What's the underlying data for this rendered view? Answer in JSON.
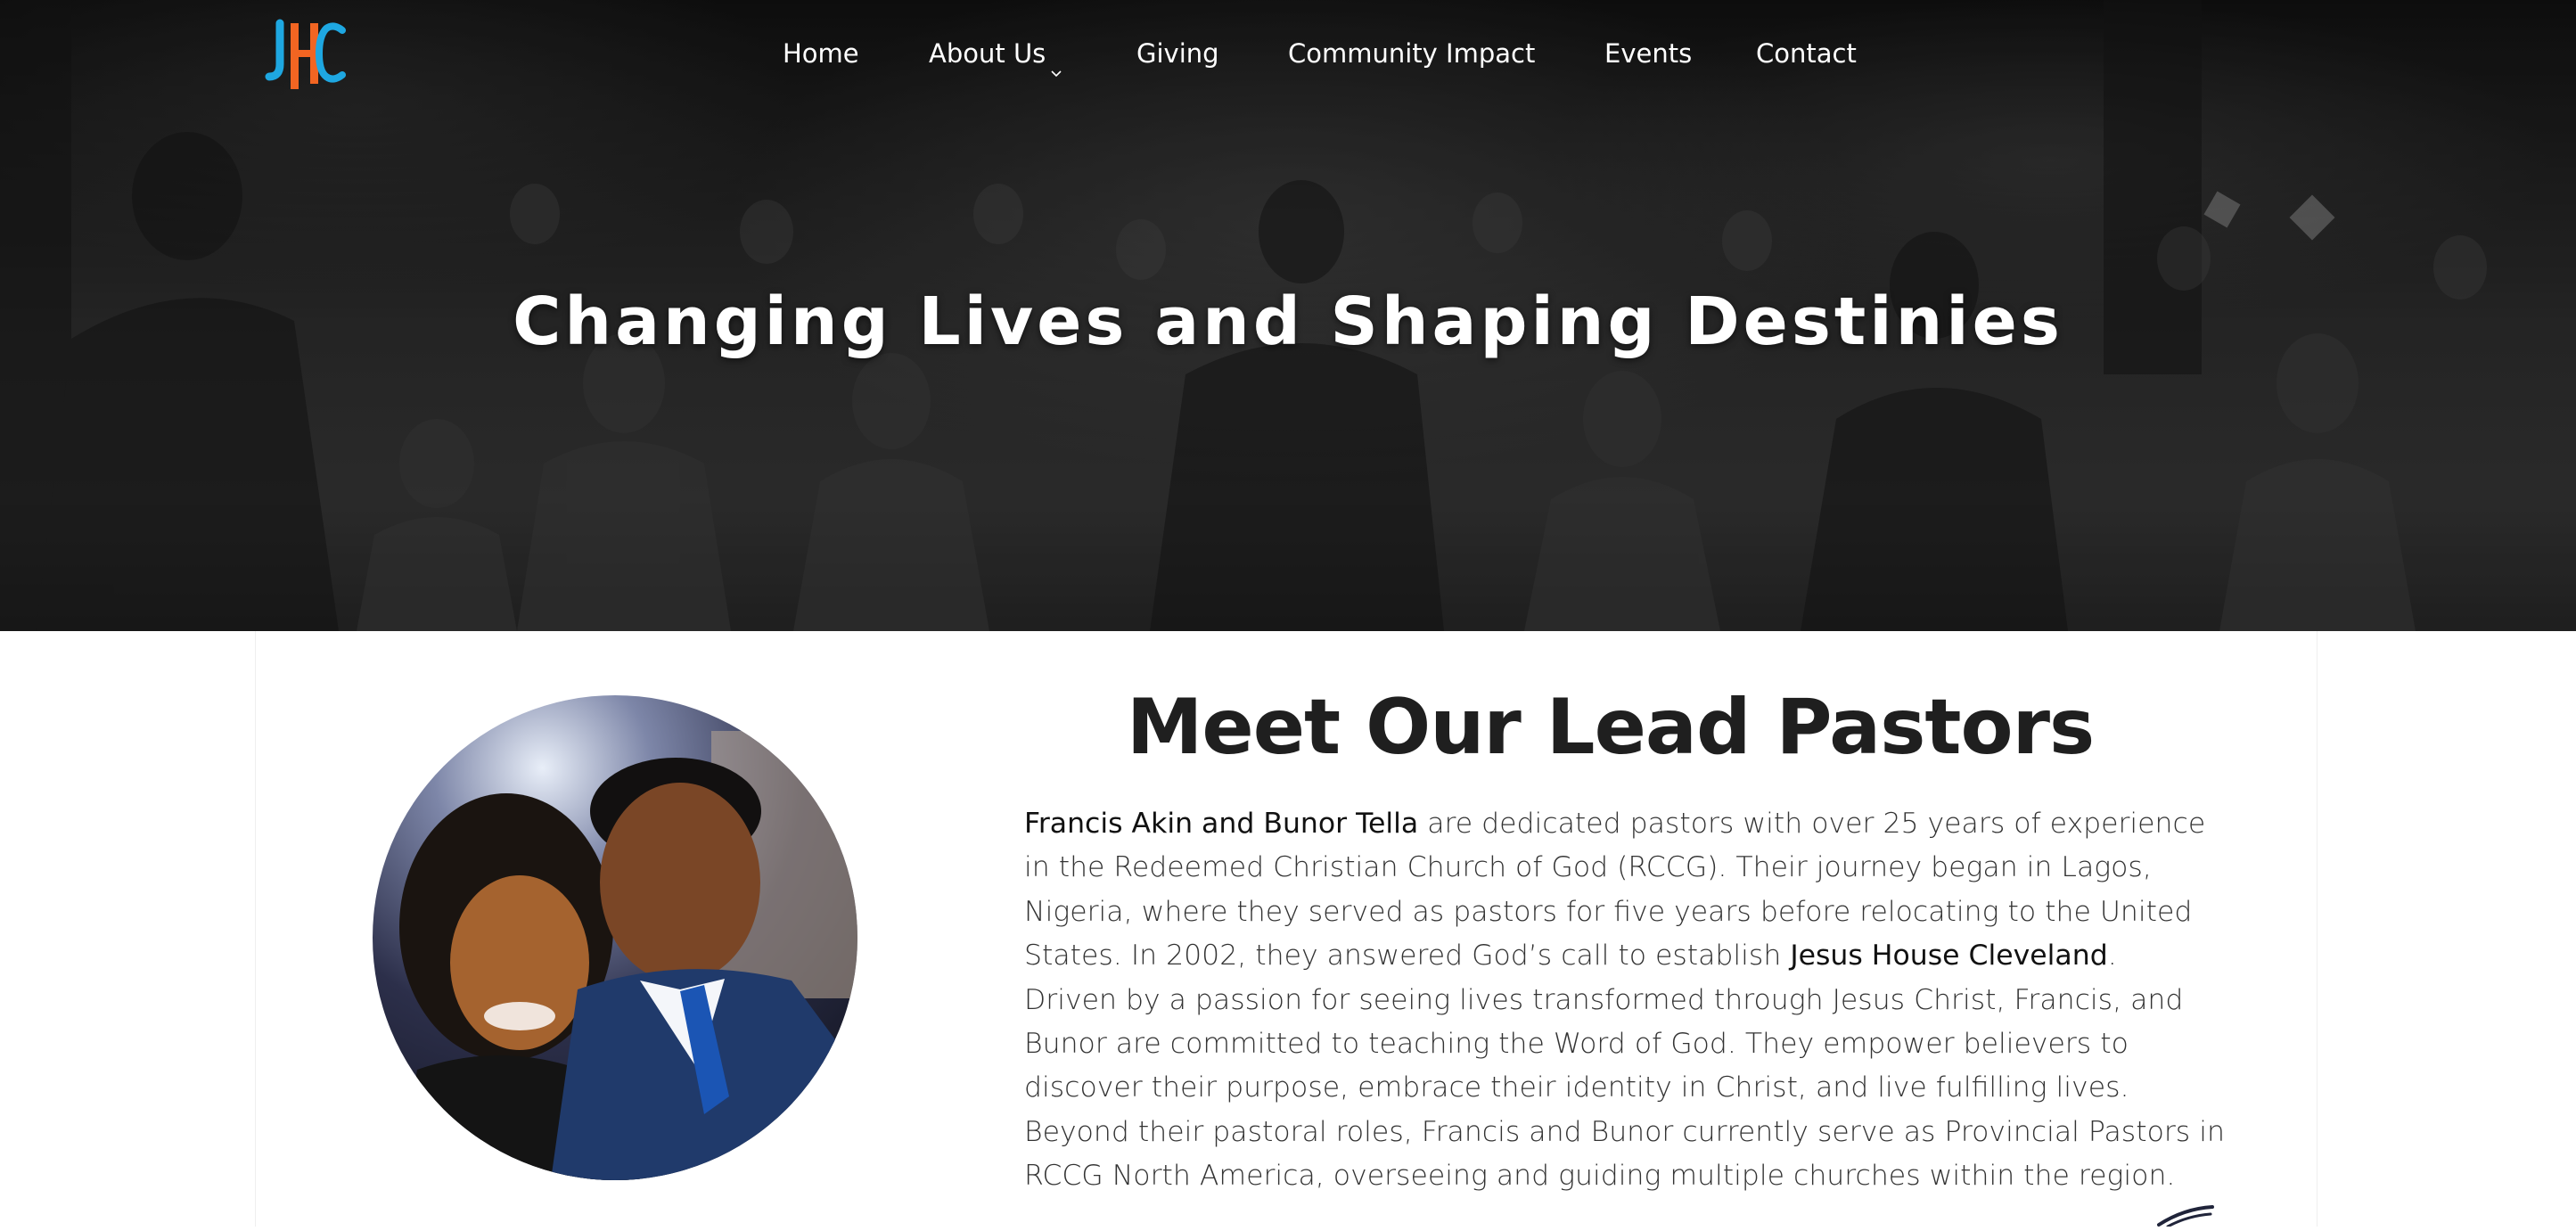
{
  "colors": {
    "logo_blue": "#1ea7e1",
    "logo_orange": "#f26522",
    "heading": "#1f1f1f",
    "body_text": "#333333",
    "nav_text": "#ffffff"
  },
  "logo": {
    "icon": "jhc-logo",
    "text": "JHC"
  },
  "nav": {
    "items": [
      {
        "label": "Home"
      },
      {
        "label": "About Us",
        "has_dropdown": true,
        "icon": "chevron-down-icon"
      },
      {
        "label": "Giving"
      },
      {
        "label": "Community Impact"
      },
      {
        "label": "Events"
      },
      {
        "label": "Contact"
      }
    ]
  },
  "hero": {
    "title": "Changing Lives and Shaping Destinies"
  },
  "pastors": {
    "title": "Meet Our Lead Pastors",
    "bio_lines": [
      {
        "parts": [
          {
            "text": "Francis Akin and Bunor Tella",
            "hl": true
          },
          {
            "text": " are dedicated pastors with over 25 years of experience"
          }
        ]
      },
      {
        "parts": [
          {
            "text": "in the Redeemed Christian Church of God (RCCG). Their journey began in Lagos,"
          }
        ]
      },
      {
        "parts": [
          {
            "text": "Nigeria, where they served as pastors for five years before relocating to the United"
          }
        ]
      },
      {
        "parts": [
          {
            "text": "States. In 2002, they answered God’s call to establish "
          },
          {
            "text": "Jesus House Cleveland",
            "hl": true
          },
          {
            "text": "."
          }
        ]
      },
      {
        "parts": [
          {
            "text": "Driven by a passion for seeing lives transformed through Jesus Christ, Francis, and"
          }
        ]
      },
      {
        "parts": [
          {
            "text": "Bunor are committed to teaching the Word of God. They empower believers to"
          }
        ]
      },
      {
        "parts": [
          {
            "text": "discover their purpose, embrace their identity in Christ, and live fulfilling lives."
          }
        ]
      },
      {
        "parts": [
          {
            "text": "Beyond their pastoral roles, Francis and Bunor currently serve as Provincial Pastors in"
          }
        ]
      },
      {
        "parts": [
          {
            "text": "RCCG North America, overseeing and guiding multiple churches within the region."
          }
        ]
      }
    ]
  }
}
